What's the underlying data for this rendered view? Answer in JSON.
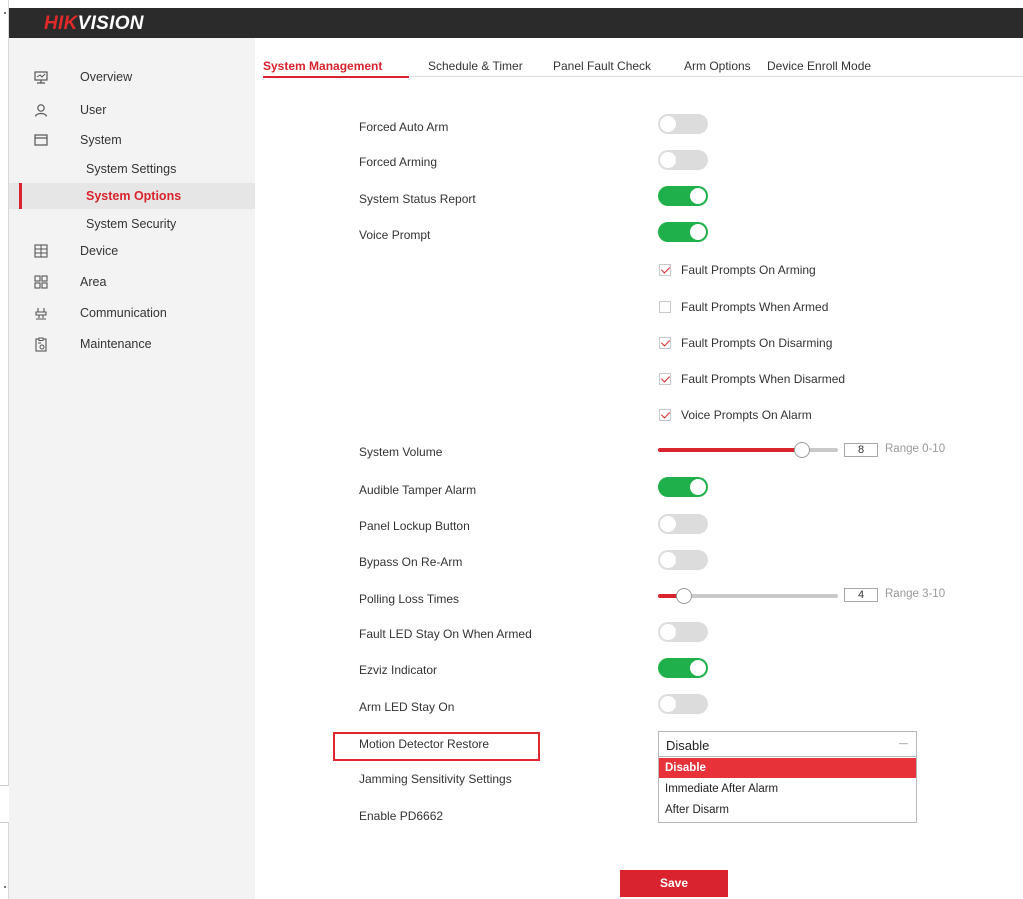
{
  "brand": {
    "logo_hik": "HIK",
    "logo_vision": "VISION"
  },
  "sidebar": {
    "items": [
      {
        "label": "Overview",
        "icon": "monitor-icon"
      },
      {
        "label": "User",
        "icon": "user-icon"
      },
      {
        "label": "System",
        "icon": "window-icon"
      },
      {
        "label": "Device",
        "icon": "device-grid-icon"
      },
      {
        "label": "Area",
        "icon": "area-grid-icon"
      },
      {
        "label": "Communication",
        "icon": "network-icon"
      },
      {
        "label": "Maintenance",
        "icon": "maintenance-icon"
      }
    ],
    "system_sub": [
      {
        "label": "System Settings"
      },
      {
        "label": "System Options",
        "active": true
      },
      {
        "label": "System Security"
      }
    ]
  },
  "tabs": [
    {
      "label": "System Management",
      "active": true
    },
    {
      "label": "Schedule & Timer"
    },
    {
      "label": "Panel Fault Check"
    },
    {
      "label": "Arm Options"
    },
    {
      "label": "Device Enroll Mode"
    }
  ],
  "settings": {
    "forced_auto_arm": {
      "label": "Forced Auto Arm",
      "on": false
    },
    "forced_arming": {
      "label": "Forced Arming",
      "on": false
    },
    "system_status_report": {
      "label": "System Status Report",
      "on": true
    },
    "voice_prompt": {
      "label": "Voice Prompt",
      "on": true
    },
    "voice_prompt_options": [
      {
        "label": "Fault Prompts On Arming",
        "checked": true
      },
      {
        "label": "Fault Prompts When Armed",
        "checked": false
      },
      {
        "label": "Fault Prompts On Disarming",
        "checked": true
      },
      {
        "label": "Fault Prompts When Disarmed",
        "checked": true
      },
      {
        "label": "Voice Prompts On Alarm",
        "checked": true
      }
    ],
    "system_volume": {
      "label": "System Volume",
      "value": "8",
      "min": 0,
      "max": 10,
      "range_text": "Range 0-10"
    },
    "audible_tamper_alarm": {
      "label": "Audible Tamper Alarm",
      "on": true
    },
    "panel_lockup_button": {
      "label": "Panel Lockup Button",
      "on": false
    },
    "bypass_on_rearm": {
      "label": "Bypass On Re-Arm",
      "on": false
    },
    "polling_loss_times": {
      "label": "Polling Loss Times",
      "value": "4",
      "min": 3,
      "max": 10,
      "range_text": "Range 3-10"
    },
    "fault_led_stay_on": {
      "label": "Fault LED Stay On When Armed",
      "on": false
    },
    "ezviz_indicator": {
      "label": "Ezviz Indicator",
      "on": true
    },
    "arm_led_stay_on": {
      "label": "Arm LED Stay On",
      "on": false
    },
    "motion_detector_restore": {
      "label": "Motion Detector Restore",
      "value": "Disable",
      "options": [
        "Disable",
        "Immediate After Alarm",
        "After Disarm"
      ]
    },
    "jamming_sensitivity": {
      "label": "Jamming Sensitivity Settings"
    },
    "enable_pd6662": {
      "label": "Enable PD6662"
    }
  },
  "save_label": "Save",
  "colors": {
    "accent": "#d9232e",
    "toggle_on": "#1fb04b",
    "toggle_off": "#dcdcdc",
    "topbar": "#2b2b2b"
  }
}
